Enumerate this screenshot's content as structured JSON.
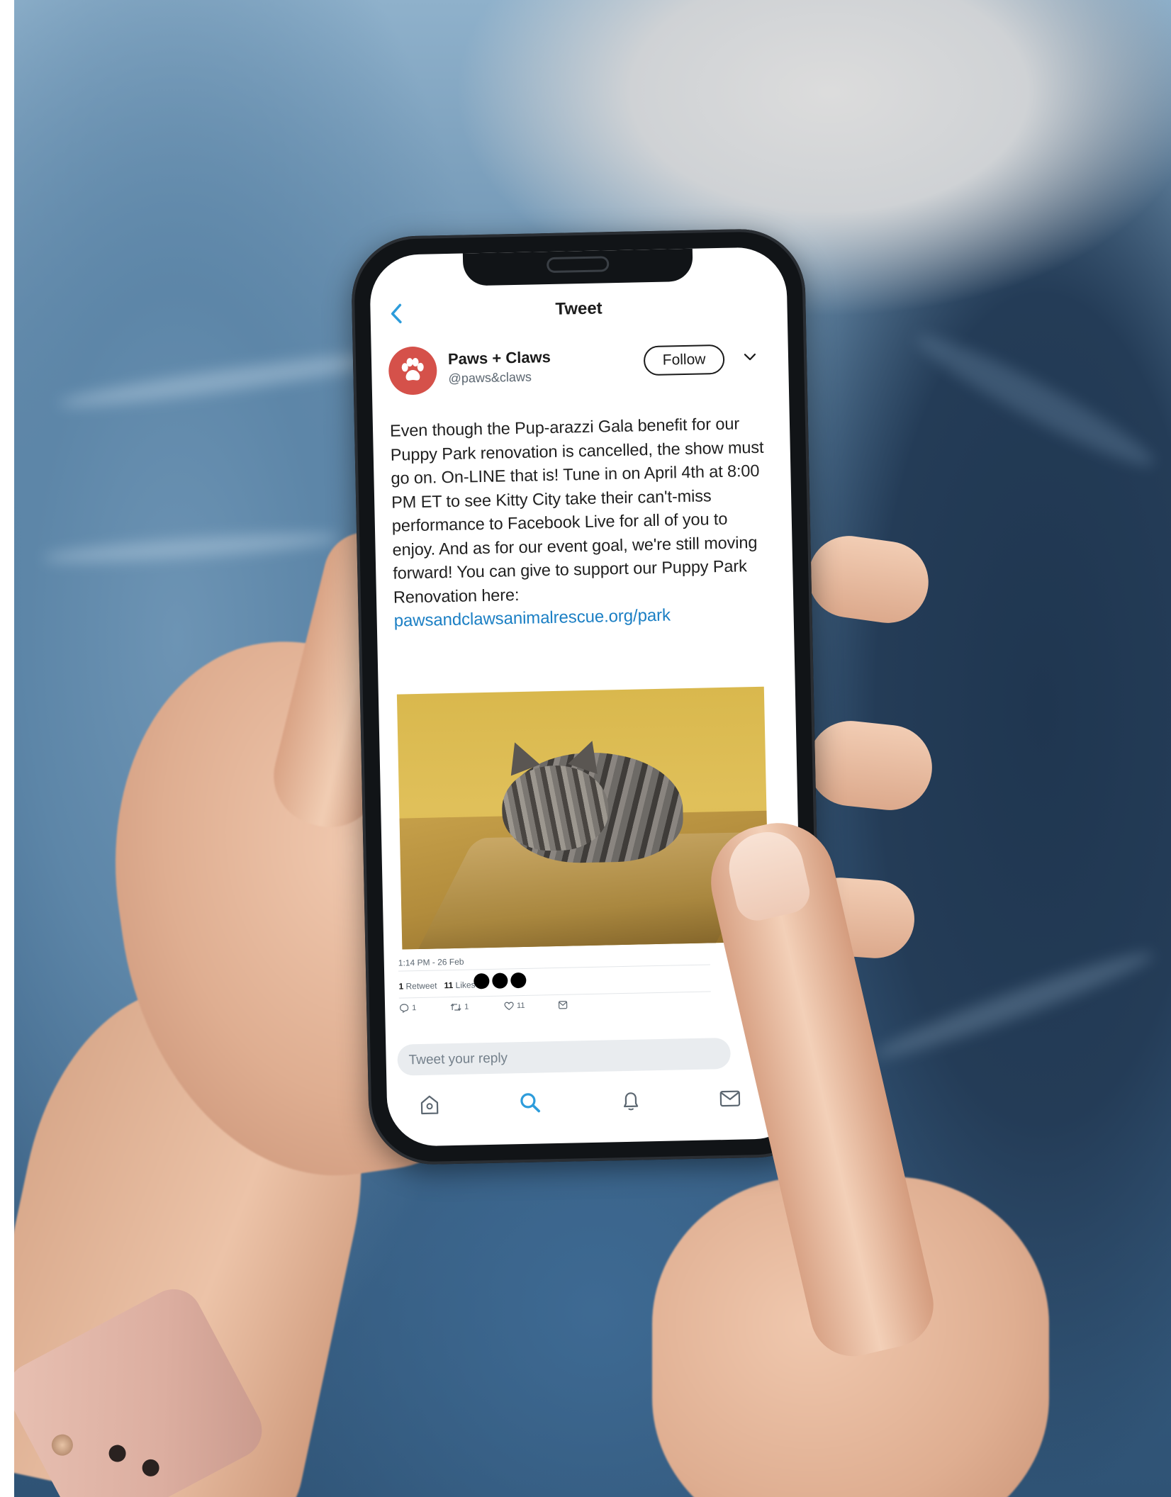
{
  "nav": {
    "title": "Tweet"
  },
  "author": {
    "display_name": "Paws + Claws",
    "handle": "@paws&claws",
    "follow_label": "Follow",
    "avatar_color": "#d5514a"
  },
  "tweet": {
    "text": "Even though the Pup-arazzi Gala benefit for our Puppy Park renovation is cancelled, the show must go on. On-LINE that is! Tune in on April 4th at 8:00 PM ET to see Kitty City take their can't-miss performance to Facebook Live for all of you to enjoy. And as for our event goal, we're still moving forward! You can give to support our Puppy Park Renovation here:",
    "link": "pawsandclawsanimalrescue.org/park",
    "timestamp": "1:14 PM - 26 Feb"
  },
  "stats": {
    "retweets_count": "1",
    "retweets_label": "Retweet",
    "likes_count": "11",
    "likes_label": "Likes"
  },
  "actions": {
    "reply_count": "1",
    "retweet_count": "1",
    "like_count": "11"
  },
  "reply": {
    "placeholder": "Tweet your reply"
  },
  "tabs": [
    {
      "icon": "home-icon"
    },
    {
      "icon": "search-icon",
      "active": true
    },
    {
      "icon": "notifications-icon"
    },
    {
      "icon": "messages-icon"
    }
  ],
  "colors": {
    "accent": "#2d9cdb",
    "link": "#1b7fc4",
    "text": "#1f1f1f",
    "muted": "#5b6670"
  }
}
